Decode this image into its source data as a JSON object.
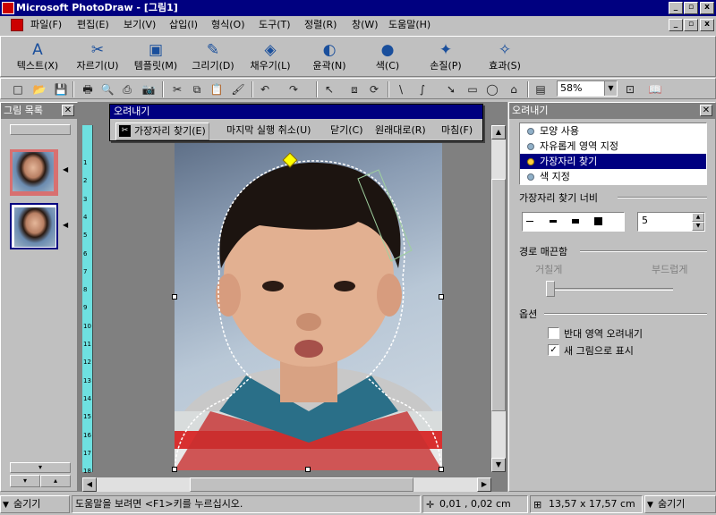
{
  "window": {
    "title": "Microsoft PhotoDraw - [그림1]",
    "buttons": [
      "_",
      "▫",
      "x"
    ],
    "doc_buttons": [
      "_",
      "▫",
      "x"
    ]
  },
  "menu": [
    "파일(F)",
    "편집(E)",
    "보기(V)",
    "삽입(I)",
    "형식(O)",
    "도구(T)",
    "정렬(R)",
    "창(W)",
    "도움말(H)"
  ],
  "big_toolbar": [
    {
      "label": "텍스트(X)",
      "icon": "text-icon",
      "glyph": "A"
    },
    {
      "label": "자르기(U)",
      "icon": "scissors-icon",
      "glyph": "✂"
    },
    {
      "label": "템플릿(M)",
      "icon": "template-icon",
      "glyph": "▣"
    },
    {
      "label": "그리기(D)",
      "icon": "pen-icon",
      "glyph": "✎"
    },
    {
      "label": "채우기(L)",
      "icon": "fill-bucket-icon",
      "glyph": "◈"
    },
    {
      "label": "윤곽(N)",
      "icon": "outline-icon",
      "glyph": "◐"
    },
    {
      "label": "색(C)",
      "icon": "color-icon",
      "glyph": "●"
    },
    {
      "label": "손질(P)",
      "icon": "touchup-icon",
      "glyph": "✦"
    },
    {
      "label": "효과(S)",
      "icon": "effects-icon",
      "glyph": "✧"
    }
  ],
  "std_toolbar": {
    "icons": [
      "new-icon",
      "open-icon",
      "save-icon",
      "print-icon",
      "print-preview-icon",
      "scan-icon",
      "camera-icon",
      "cut-icon",
      "copy-icon",
      "paste-icon",
      "format-painter-icon",
      "undo-icon",
      "redo-icon",
      "pointer-icon",
      "group-icon",
      "rotate-icon",
      "line-icon",
      "curve-icon",
      "arrow-icon",
      "rectangle-icon",
      "ellipse-icon",
      "autoshape-icon",
      "gallery-icon",
      "fit-icon",
      "help-book-icon"
    ],
    "glyphs": [
      "□",
      "📂",
      "💾",
      "🖶",
      "🔍",
      "⎙",
      "📷",
      "✂",
      "⧉",
      "📋",
      "🖌",
      "↶",
      "↷",
      "↖",
      "⧈",
      "⟳",
      "\\",
      "∫",
      "➘",
      "▭",
      "◯",
      "⌂",
      "▤",
      "⊡",
      "📖"
    ],
    "zoom": "58%"
  },
  "left_panel": {
    "title": "그림 목록",
    "scroll_down": "▾",
    "scroll_up": "▴"
  },
  "crop_toolbar": {
    "title": "오려내기",
    "items": [
      "가장자리 찾기(E)",
      "마지막 실행 취소(U)",
      "닫기(C)",
      "원래대로(R)",
      "마침(F)"
    ]
  },
  "ruler": {
    "ticks": [
      "1",
      "2",
      "3",
      "4",
      "5",
      "6",
      "7",
      "8",
      "9",
      "10",
      "11",
      "12",
      "13",
      "14",
      "15",
      "16",
      "17",
      "18"
    ]
  },
  "right_panel": {
    "title": "오려내기",
    "options": [
      "모양 사용",
      "자유롭게 영역 지정",
      "가장자리 찾기",
      "색 지정"
    ],
    "selected_index": 2,
    "width_label": "가장자리 찾기 너비",
    "width_value": "5",
    "smooth_label": "경로 매끈함",
    "rough_label": "거칠게",
    "smooth_end_label": "부드럽게",
    "smooth_level": 0.0,
    "options_label": "옵션",
    "checkboxes": [
      {
        "label": "반대 영역 오려내기",
        "checked": false
      },
      {
        "label": "새 그림으로 표시",
        "checked": true
      }
    ]
  },
  "statusbar": {
    "hide_left": "숨기기",
    "help_text": "도움말을 보려면 <F1>키를 누르십시오.",
    "position": "0,01 , 0,02 cm",
    "size": "13,57 x 17,57 cm",
    "hide_right": "숨기기"
  },
  "colors": {
    "title_bg": "#000080",
    "ruler": "#6ee0e0",
    "selection": "#000080",
    "handle": "#ffff00"
  }
}
